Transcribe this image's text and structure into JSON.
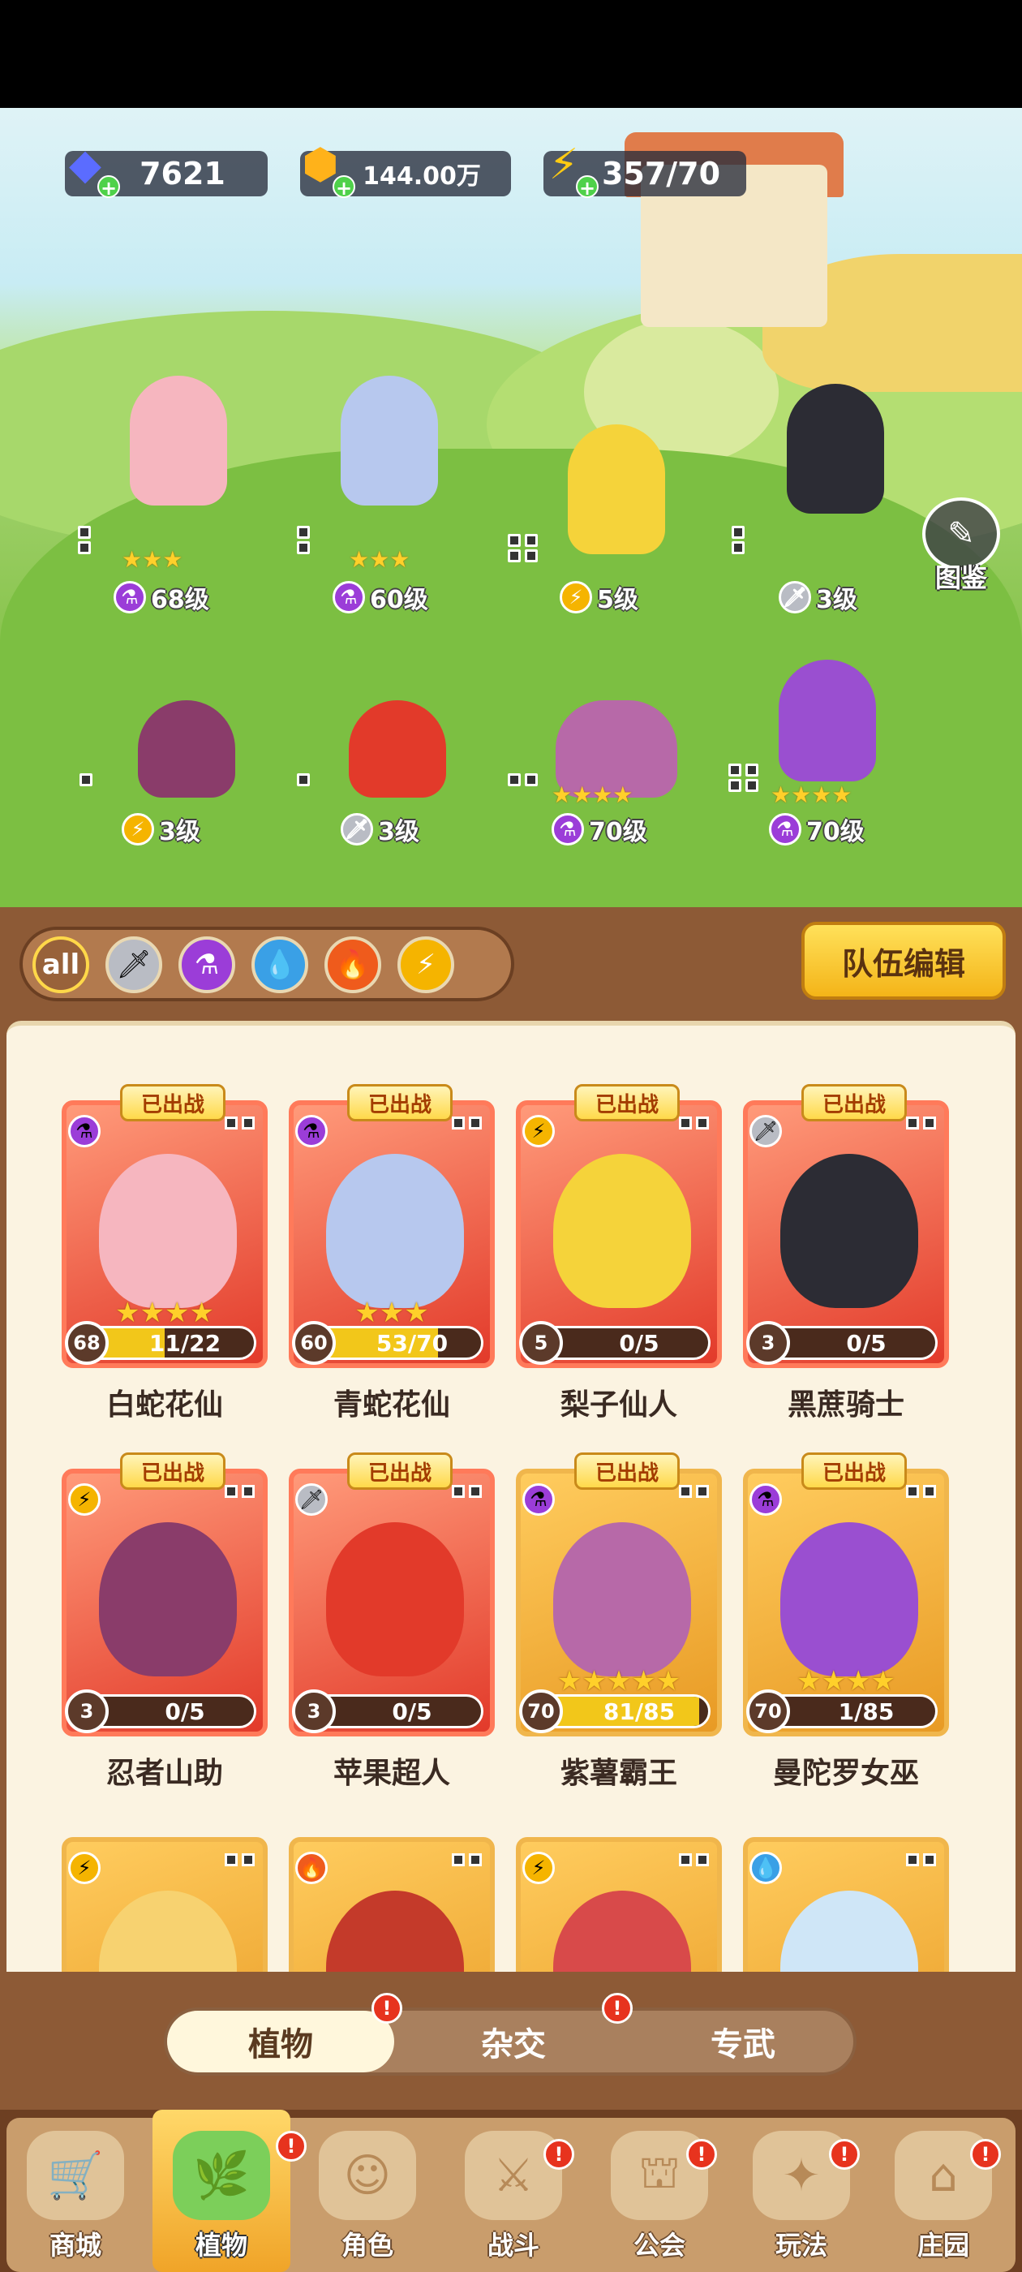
{
  "resources": {
    "gems": {
      "value": "7621",
      "icon": "gem-icon"
    },
    "coins": {
      "value": "144.00万",
      "icon": "coin-icon"
    },
    "energy": {
      "value": "357/70",
      "icon": "energy-icon"
    }
  },
  "scene": {
    "tujian_label": "图鉴",
    "heroes": [
      {
        "level": "68级",
        "class": "potion",
        "stars": 3
      },
      {
        "level": "60级",
        "class": "potion",
        "stars": 3
      },
      {
        "level": "5级",
        "class": "bolt",
        "stars": 0
      },
      {
        "level": "3级",
        "class": "sword",
        "stars": 0
      },
      {
        "level": "3级",
        "class": "bolt",
        "stars": 0
      },
      {
        "level": "3级",
        "class": "sword",
        "stars": 0
      },
      {
        "level": "70级",
        "class": "potion",
        "stars": 4
      },
      {
        "level": "70级",
        "class": "potion",
        "stars": 4
      }
    ]
  },
  "filters": {
    "all_label": "all",
    "items": [
      "sword-icon",
      "potion-icon",
      "water-drop-icon",
      "fire-icon",
      "lightning-icon"
    ],
    "team_edit_label": "队伍编辑"
  },
  "deployed_tag": "已出战",
  "cards": [
    {
      "name": "白蛇花仙",
      "level": "68",
      "progress": "11/22",
      "fraction": 0.5,
      "stars": 4,
      "class": "potion",
      "deployed": true
    },
    {
      "name": "青蛇花仙",
      "level": "60",
      "progress": "53/70",
      "fraction": 0.76,
      "stars": 3,
      "class": "potion",
      "deployed": true
    },
    {
      "name": "梨子仙人",
      "level": "5",
      "progress": "0/5",
      "fraction": 0,
      "stars": 0,
      "class": "bolt",
      "deployed": true
    },
    {
      "name": "黑蔗骑士",
      "level": "3",
      "progress": "0/5",
      "fraction": 0,
      "stars": 0,
      "class": "sword",
      "deployed": true
    },
    {
      "name": "忍者山助",
      "level": "3",
      "progress": "0/5",
      "fraction": 0,
      "stars": 0,
      "class": "bolt",
      "deployed": true
    },
    {
      "name": "苹果超人",
      "level": "3",
      "progress": "0/5",
      "fraction": 0,
      "stars": 0,
      "class": "sword",
      "deployed": true
    },
    {
      "name": "紫薯霸王",
      "level": "70",
      "progress": "81/85",
      "fraction": 0.95,
      "stars": 5,
      "class": "potion",
      "deployed": true
    },
    {
      "name": "曼陀罗女巫",
      "level": "70",
      "progress": "1/85",
      "fraction": 0.01,
      "stars": 4,
      "class": "potion",
      "deployed": true
    },
    {
      "name": "",
      "class": "bolt"
    },
    {
      "name": "",
      "class": "fire"
    },
    {
      "name": "",
      "class": "bolt"
    },
    {
      "name": "",
      "class": "drop"
    }
  ],
  "sub_tabs": [
    "植物",
    "杂交",
    "专武"
  ],
  "badge": "!",
  "nav": [
    "商城",
    "植物",
    "角色",
    "战斗",
    "公会",
    "玩法",
    "庄园"
  ],
  "colors": {
    "accent": "#ffd849",
    "panel": "#8d5a36",
    "badge": "#e7331e"
  }
}
